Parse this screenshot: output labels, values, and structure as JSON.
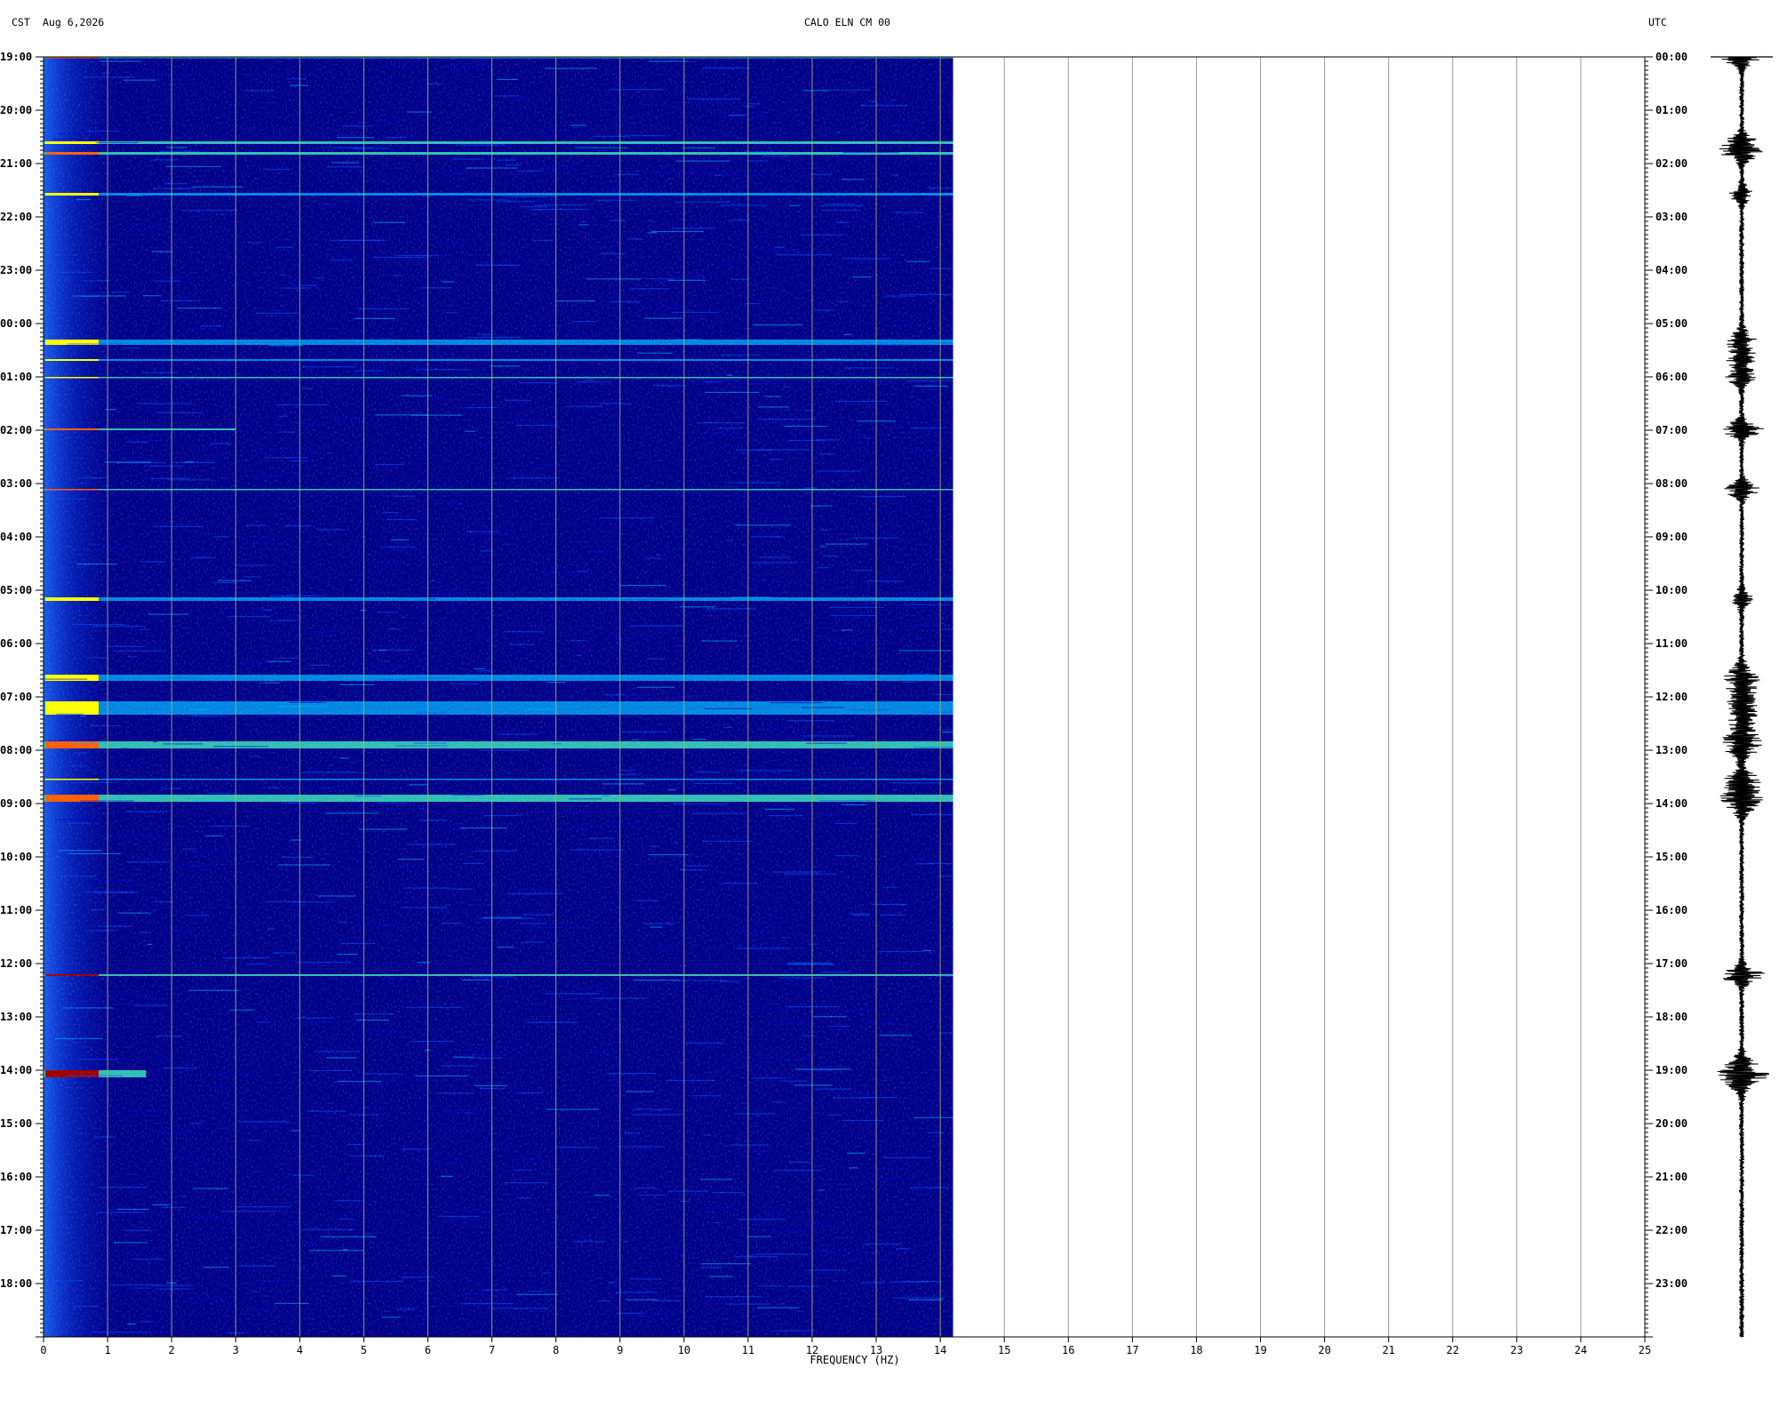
{
  "header": {
    "tz_left": "CST",
    "date": "Aug 6,2026",
    "station": "CALO ELN CM 00",
    "tz_right": "UTC"
  },
  "chart_data": {
    "type": "heatmap",
    "title": "CALO ELN CM 00",
    "xlabel": "FREQUENCY (HZ)",
    "ylabel_left": "CST",
    "ylabel_right": "UTC",
    "xlim": [
      0,
      25
    ],
    "data_xmax": 14.2,
    "x_ticks": [
      "0",
      "1",
      "2",
      "3",
      "4",
      "5",
      "6",
      "7",
      "8",
      "9",
      "10",
      "11",
      "12",
      "13",
      "14",
      "15",
      "16",
      "17",
      "18",
      "19",
      "20",
      "21",
      "22",
      "23",
      "24",
      "25"
    ],
    "y_ticks_left": [
      "19:00",
      "20:00",
      "21:00",
      "22:00",
      "23:00",
      "00:00",
      "01:00",
      "02:00",
      "03:00",
      "04:00",
      "05:00",
      "06:00",
      "07:00",
      "08:00",
      "09:00",
      "10:00",
      "11:00",
      "12:00",
      "13:00",
      "14:00",
      "15:00",
      "16:00",
      "17:00",
      "18:00"
    ],
    "y_ticks_right": [
      "00:00",
      "01:00",
      "02:00",
      "03:00",
      "04:00",
      "05:00",
      "06:00",
      "07:00",
      "08:00",
      "09:00",
      "10:00",
      "11:00",
      "12:00",
      "13:00",
      "14:00",
      "15:00",
      "16:00",
      "17:00",
      "18:00",
      "19:00",
      "20:00",
      "21:00",
      "22:00",
      "23:00"
    ],
    "time_span_hours": 24,
    "grid": true,
    "colormap": [
      "#000080",
      "#0000cd",
      "#0050ff",
      "#00b4ff",
      "#40ffbf",
      "#ffff00",
      "#ff6000",
      "#a00000"
    ],
    "background_color": "#00008b",
    "grid_color": "#b8b060",
    "features": [
      {
        "utc_start": "00:00",
        "utc_end": "00:01",
        "f_max": 14.2,
        "intensity": 0.8
      },
      {
        "utc_start": "01:35",
        "utc_end": "01:38",
        "f_max": 14.2,
        "intensity": 0.6
      },
      {
        "utc_start": "01:47",
        "utc_end": "01:50",
        "f_max": 14.2,
        "intensity": 0.7
      },
      {
        "utc_start": "02:33",
        "utc_end": "02:36",
        "f_max": 14.2,
        "intensity": 0.45
      },
      {
        "utc_start": "05:18",
        "utc_end": "05:24",
        "f_max": 14.2,
        "intensity": 0.55
      },
      {
        "utc_start": "05:40",
        "utc_end": "05:42",
        "f_max": 14.2,
        "intensity": 0.55
      },
      {
        "utc_start": "06:00",
        "utc_end": "06:01",
        "f_max": 14.2,
        "intensity": 0.6
      },
      {
        "utc_start": "06:58",
        "utc_end": "07:00",
        "f_max": 3.0,
        "intensity": 0.8
      },
      {
        "utc_start": "08:06",
        "utc_end": "08:07",
        "f_max": 14.2,
        "intensity": 0.7
      },
      {
        "utc_start": "10:08",
        "utc_end": "10:12",
        "f_max": 14.2,
        "intensity": 0.4
      },
      {
        "utc_start": "11:35",
        "utc_end": "11:42",
        "f_max": 14.2,
        "intensity": 0.5
      },
      {
        "utc_start": "12:05",
        "utc_end": "12:20",
        "f_max": 14.2,
        "intensity": 0.55
      },
      {
        "utc_start": "12:50",
        "utc_end": "12:58",
        "f_max": 14.2,
        "intensity": 0.65
      },
      {
        "utc_start": "13:32",
        "utc_end": "13:33",
        "f_max": 14.2,
        "intensity": 0.55
      },
      {
        "utc_start": "13:50",
        "utc_end": "13:58",
        "f_max": 14.2,
        "intensity": 0.8
      },
      {
        "utc_start": "17:12",
        "utc_end": "17:14",
        "f_max": 14.2,
        "intensity": 0.9
      },
      {
        "utc_start": "19:00",
        "utc_end": "19:08",
        "f_max": 1.6,
        "intensity": 1.0
      }
    ]
  }
}
